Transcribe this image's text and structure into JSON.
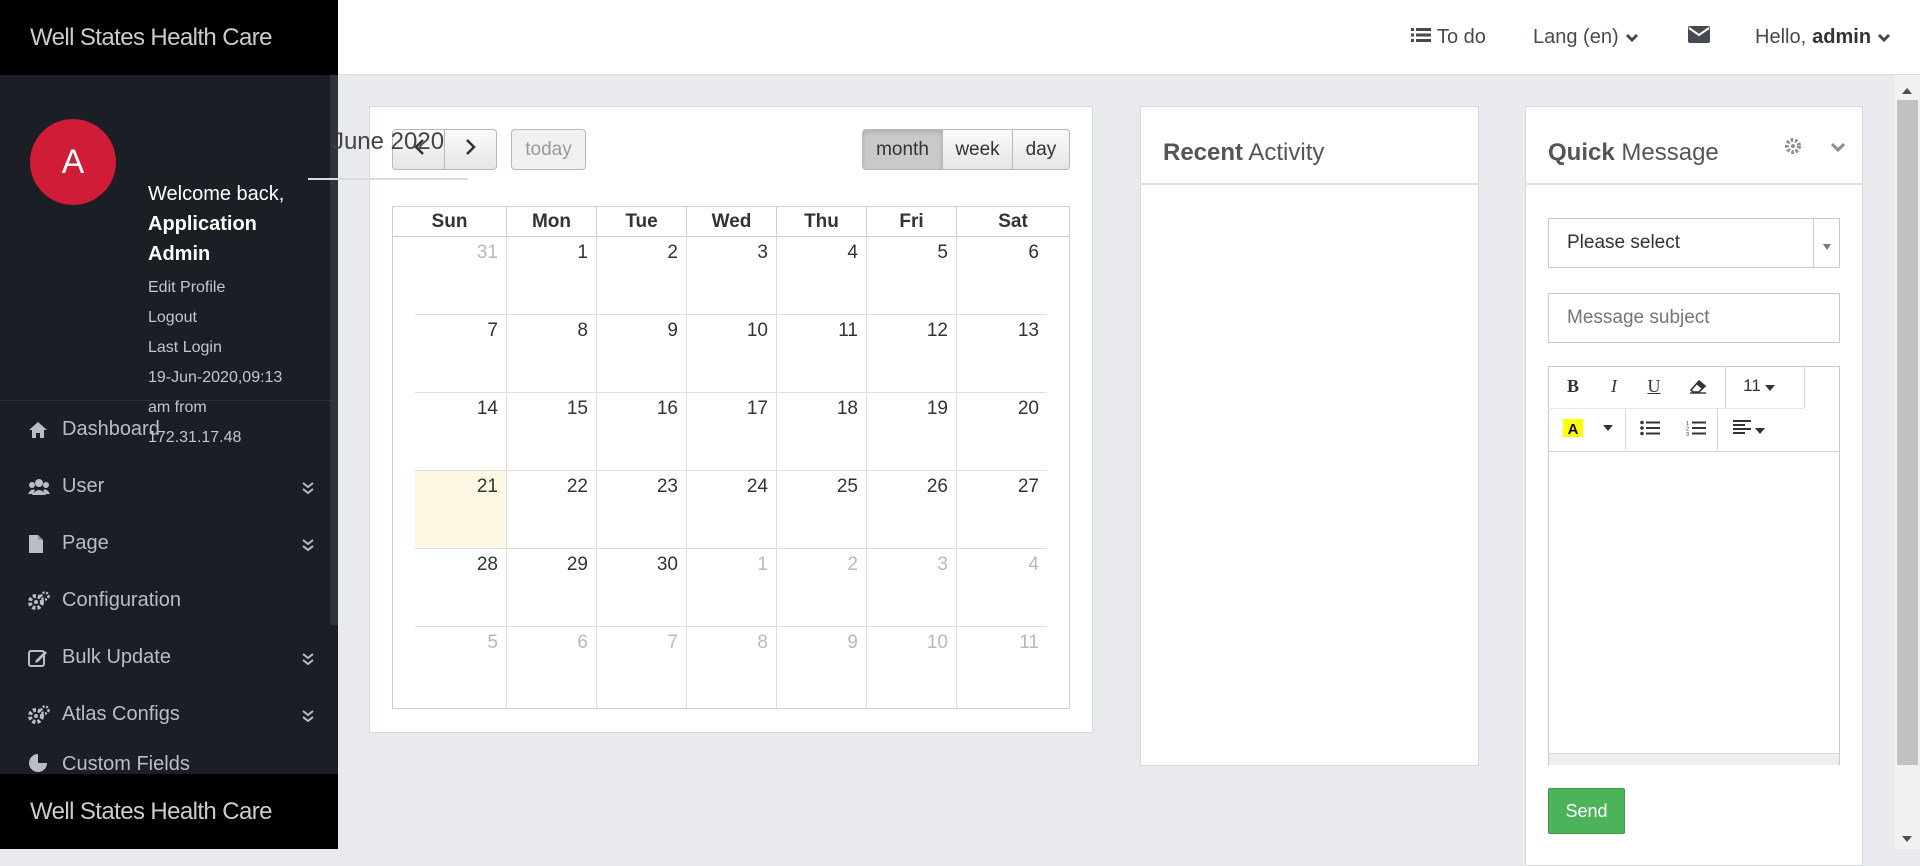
{
  "app": {
    "brand": "Well States Health Care",
    "brand_footer": "Well States Health Care"
  },
  "profile": {
    "avatar_letter": "A",
    "welcome": "Welcome back,",
    "name": "Application Admin",
    "edit_profile": "Edit Profile",
    "logout": "Logout",
    "last_login_label": "Last Login",
    "last_login_value": "19-Jun-2020,09:13 am from 172.31.17.48"
  },
  "sidebar": {
    "items": [
      {
        "label": "Dashboard",
        "icon": "home-icon",
        "has_children": false
      },
      {
        "label": "User",
        "icon": "users-icon",
        "has_children": true
      },
      {
        "label": "Page",
        "icon": "file-icon",
        "has_children": true
      },
      {
        "label": "Configuration",
        "icon": "cogs-icon",
        "has_children": false
      },
      {
        "label": "Bulk Update",
        "icon": "edit-icon",
        "has_children": true
      },
      {
        "label": "Atlas Configs",
        "icon": "cogs-icon",
        "has_children": true
      },
      {
        "label": "Custom Fields",
        "icon": "pie-chart-icon",
        "has_children": false
      }
    ]
  },
  "topbar": {
    "todo": "To do",
    "lang": "Lang (en)",
    "hello": "Hello,",
    "user": "admin"
  },
  "calendar": {
    "title": "June 2020",
    "today_label": "today",
    "views": [
      "month",
      "week",
      "day"
    ],
    "active_view": "month",
    "weekdays": [
      "Sun",
      "Mon",
      "Tue",
      "Wed",
      "Thu",
      "Fri",
      "Sat"
    ],
    "weeks": [
      [
        "31",
        "1",
        "2",
        "3",
        "4",
        "5",
        "6"
      ],
      [
        "7",
        "8",
        "9",
        "10",
        "11",
        "12",
        "13"
      ],
      [
        "14",
        "15",
        "16",
        "17",
        "18",
        "19",
        "20"
      ],
      [
        "21",
        "22",
        "23",
        "24",
        "25",
        "26",
        "27"
      ],
      [
        "28",
        "29",
        "30",
        "1",
        "2",
        "3",
        "4"
      ],
      [
        "5",
        "6",
        "7",
        "8",
        "9",
        "10",
        "11"
      ]
    ],
    "today_date": "21"
  },
  "recent_activity": {
    "title_bold": "Recent",
    "title_rest": "Activity"
  },
  "quick_message": {
    "title_bold": "Quick",
    "title_rest": "Message",
    "recipient_selected": "Please select",
    "subject_placeholder": "Message subject",
    "font_size": "11",
    "send_label": "Send"
  }
}
